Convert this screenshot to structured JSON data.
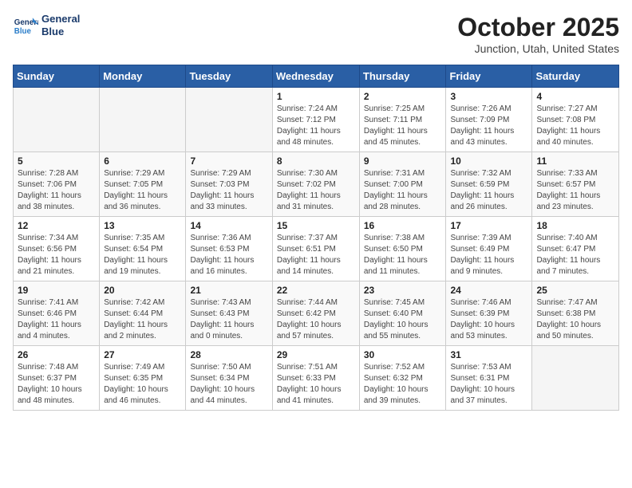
{
  "header": {
    "logo_line1": "General",
    "logo_line2": "Blue",
    "month": "October 2025",
    "location": "Junction, Utah, United States"
  },
  "weekdays": [
    "Sunday",
    "Monday",
    "Tuesday",
    "Wednesday",
    "Thursday",
    "Friday",
    "Saturday"
  ],
  "weeks": [
    [
      {
        "day": "",
        "info": ""
      },
      {
        "day": "",
        "info": ""
      },
      {
        "day": "",
        "info": ""
      },
      {
        "day": "1",
        "info": "Sunrise: 7:24 AM\nSunset: 7:12 PM\nDaylight: 11 hours and 48 minutes."
      },
      {
        "day": "2",
        "info": "Sunrise: 7:25 AM\nSunset: 7:11 PM\nDaylight: 11 hours and 45 minutes."
      },
      {
        "day": "3",
        "info": "Sunrise: 7:26 AM\nSunset: 7:09 PM\nDaylight: 11 hours and 43 minutes."
      },
      {
        "day": "4",
        "info": "Sunrise: 7:27 AM\nSunset: 7:08 PM\nDaylight: 11 hours and 40 minutes."
      }
    ],
    [
      {
        "day": "5",
        "info": "Sunrise: 7:28 AM\nSunset: 7:06 PM\nDaylight: 11 hours and 38 minutes."
      },
      {
        "day": "6",
        "info": "Sunrise: 7:29 AM\nSunset: 7:05 PM\nDaylight: 11 hours and 36 minutes."
      },
      {
        "day": "7",
        "info": "Sunrise: 7:29 AM\nSunset: 7:03 PM\nDaylight: 11 hours and 33 minutes."
      },
      {
        "day": "8",
        "info": "Sunrise: 7:30 AM\nSunset: 7:02 PM\nDaylight: 11 hours and 31 minutes."
      },
      {
        "day": "9",
        "info": "Sunrise: 7:31 AM\nSunset: 7:00 PM\nDaylight: 11 hours and 28 minutes."
      },
      {
        "day": "10",
        "info": "Sunrise: 7:32 AM\nSunset: 6:59 PM\nDaylight: 11 hours and 26 minutes."
      },
      {
        "day": "11",
        "info": "Sunrise: 7:33 AM\nSunset: 6:57 PM\nDaylight: 11 hours and 23 minutes."
      }
    ],
    [
      {
        "day": "12",
        "info": "Sunrise: 7:34 AM\nSunset: 6:56 PM\nDaylight: 11 hours and 21 minutes."
      },
      {
        "day": "13",
        "info": "Sunrise: 7:35 AM\nSunset: 6:54 PM\nDaylight: 11 hours and 19 minutes."
      },
      {
        "day": "14",
        "info": "Sunrise: 7:36 AM\nSunset: 6:53 PM\nDaylight: 11 hours and 16 minutes."
      },
      {
        "day": "15",
        "info": "Sunrise: 7:37 AM\nSunset: 6:51 PM\nDaylight: 11 hours and 14 minutes."
      },
      {
        "day": "16",
        "info": "Sunrise: 7:38 AM\nSunset: 6:50 PM\nDaylight: 11 hours and 11 minutes."
      },
      {
        "day": "17",
        "info": "Sunrise: 7:39 AM\nSunset: 6:49 PM\nDaylight: 11 hours and 9 minutes."
      },
      {
        "day": "18",
        "info": "Sunrise: 7:40 AM\nSunset: 6:47 PM\nDaylight: 11 hours and 7 minutes."
      }
    ],
    [
      {
        "day": "19",
        "info": "Sunrise: 7:41 AM\nSunset: 6:46 PM\nDaylight: 11 hours and 4 minutes."
      },
      {
        "day": "20",
        "info": "Sunrise: 7:42 AM\nSunset: 6:44 PM\nDaylight: 11 hours and 2 minutes."
      },
      {
        "day": "21",
        "info": "Sunrise: 7:43 AM\nSunset: 6:43 PM\nDaylight: 11 hours and 0 minutes."
      },
      {
        "day": "22",
        "info": "Sunrise: 7:44 AM\nSunset: 6:42 PM\nDaylight: 10 hours and 57 minutes."
      },
      {
        "day": "23",
        "info": "Sunrise: 7:45 AM\nSunset: 6:40 PM\nDaylight: 10 hours and 55 minutes."
      },
      {
        "day": "24",
        "info": "Sunrise: 7:46 AM\nSunset: 6:39 PM\nDaylight: 10 hours and 53 minutes."
      },
      {
        "day": "25",
        "info": "Sunrise: 7:47 AM\nSunset: 6:38 PM\nDaylight: 10 hours and 50 minutes."
      }
    ],
    [
      {
        "day": "26",
        "info": "Sunrise: 7:48 AM\nSunset: 6:37 PM\nDaylight: 10 hours and 48 minutes."
      },
      {
        "day": "27",
        "info": "Sunrise: 7:49 AM\nSunset: 6:35 PM\nDaylight: 10 hours and 46 minutes."
      },
      {
        "day": "28",
        "info": "Sunrise: 7:50 AM\nSunset: 6:34 PM\nDaylight: 10 hours and 44 minutes."
      },
      {
        "day": "29",
        "info": "Sunrise: 7:51 AM\nSunset: 6:33 PM\nDaylight: 10 hours and 41 minutes."
      },
      {
        "day": "30",
        "info": "Sunrise: 7:52 AM\nSunset: 6:32 PM\nDaylight: 10 hours and 39 minutes."
      },
      {
        "day": "31",
        "info": "Sunrise: 7:53 AM\nSunset: 6:31 PM\nDaylight: 10 hours and 37 minutes."
      },
      {
        "day": "",
        "info": ""
      }
    ]
  ]
}
